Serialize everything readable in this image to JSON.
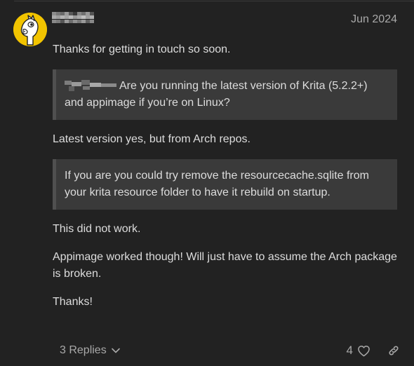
{
  "post": {
    "date": "Jun 2024",
    "paragraph_1": "Thanks for getting in touch so soon.",
    "quote_1_text": "Are you running the latest version of Krita (5.2.2+) and appimage if you’re on Linux?",
    "paragraph_2": "Latest version yes, but from Arch repos.",
    "quote_2_text": "If you are you could try remove the resourcecache.sqlite from your krita resource folder to have it rebuild on startup.",
    "paragraph_3": "This did not work.",
    "paragraph_4": "Appimage worked though! Will just have to assume the Arch package is broken.",
    "paragraph_5": "Thanks!"
  },
  "controls": {
    "replies_label": "3 Replies",
    "like_count": "4"
  },
  "icons": {
    "avatar": "horse-avatar",
    "replies": "chevron-down-icon",
    "like": "heart-icon",
    "link": "link-icon"
  },
  "colors": {
    "background": "#222222",
    "text": "#dddddd",
    "muted": "#a9a9a9",
    "quote_bg": "#3a3a3a",
    "quote_border": "#505050",
    "avatar_bg": "#f2c400"
  }
}
